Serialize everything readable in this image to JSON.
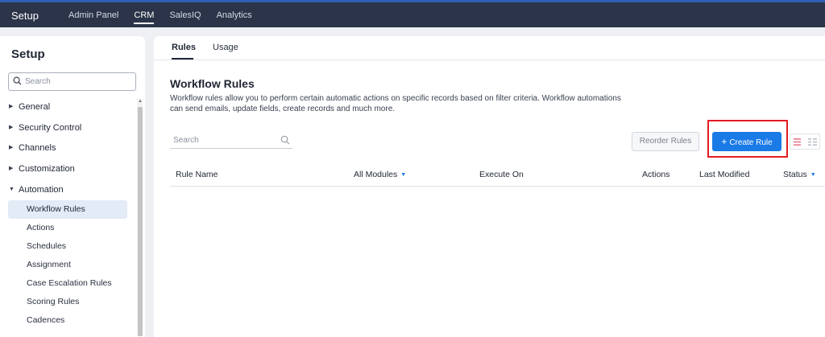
{
  "topbar": {
    "brand": "Setup",
    "nav": [
      {
        "label": "Admin Panel"
      },
      {
        "label": "CRM"
      },
      {
        "label": "SalesIQ"
      },
      {
        "label": "Analytics"
      }
    ],
    "active_nav": "CRM"
  },
  "sidebar": {
    "title": "Setup",
    "search_placeholder": "Search",
    "sections": [
      {
        "label": "General",
        "expanded": false
      },
      {
        "label": "Security Control",
        "expanded": false
      },
      {
        "label": "Channels",
        "expanded": false
      },
      {
        "label": "Customization",
        "expanded": false
      },
      {
        "label": "Automation",
        "expanded": true
      }
    ],
    "automation_items": [
      {
        "label": "Workflow Rules",
        "active": true
      },
      {
        "label": "Actions"
      },
      {
        "label": "Schedules"
      },
      {
        "label": "Assignment"
      },
      {
        "label": "Case Escalation Rules"
      },
      {
        "label": "Scoring Rules"
      },
      {
        "label": "Cadences"
      }
    ]
  },
  "main": {
    "tabs": [
      {
        "label": "Rules",
        "active": true
      },
      {
        "label": "Usage"
      }
    ],
    "title": "Workflow Rules",
    "description": "Workflow rules allow you to perform certain automatic actions on specific records based on filter criteria. Workflow automations can send emails, update fields, create records and much more.",
    "search_placeholder": "Search",
    "reorder_label": "Reorder Rules",
    "create_label": "Create Rule",
    "create_icon": "+",
    "columns": [
      {
        "label": "Rule Name"
      },
      {
        "label": "All Modules",
        "dropdown": true
      },
      {
        "label": "Execute On"
      },
      {
        "label": "Actions"
      },
      {
        "label": "Last Modified"
      },
      {
        "label": "Status",
        "dropdown": true
      }
    ]
  },
  "colors": {
    "topbar": "#2b3448",
    "primary": "#1a7ae6",
    "highlight_frame": "#e31b23",
    "active_item_bg": "#e3ebf7"
  },
  "icons": {
    "search": "search-icon",
    "caret_right": "caret-right-icon",
    "caret_down": "caret-down-icon",
    "list_view": "list-view-icon",
    "grid_view": "grid-view-icon"
  }
}
